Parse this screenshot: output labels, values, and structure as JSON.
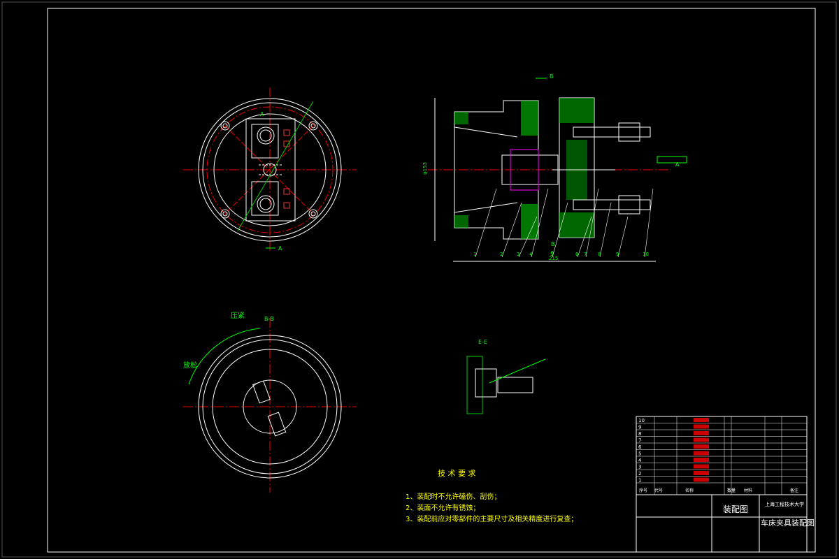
{
  "views": {
    "section_a": "A",
    "section_b": "B",
    "section_bb": "B-B",
    "section_ee": "E-E",
    "label_yajin": "压紧",
    "label_fangsong": "放松",
    "dim_diameter": "φ153",
    "dim_length": "215",
    "dim_length2": "5"
  },
  "balloons": [
    "1",
    "2",
    "3",
    "4",
    "5",
    "6",
    "7",
    "8",
    "9",
    "10"
  ],
  "tech": {
    "title": "技 术 要 求",
    "items": [
      "1、装配时不允许磕伤、刮伤；",
      "2、装面不允许有锈蚀；",
      "3、装配前应对零部件的主要尺寸及相关精度进行复查；"
    ]
  },
  "title_block": {
    "school": "上海工程技术大学",
    "drawing_type": "装配图",
    "drawing_name": "车床夹具装配图"
  },
  "bom_rows": [
    "10",
    "9",
    "8",
    "7",
    "6",
    "5",
    "4",
    "3",
    "2",
    "1"
  ],
  "bom_header": {
    "col1": "序号",
    "col2": "代号",
    "col3": "名称",
    "col4": "数量",
    "col5": "材料",
    "col6": "备注"
  }
}
